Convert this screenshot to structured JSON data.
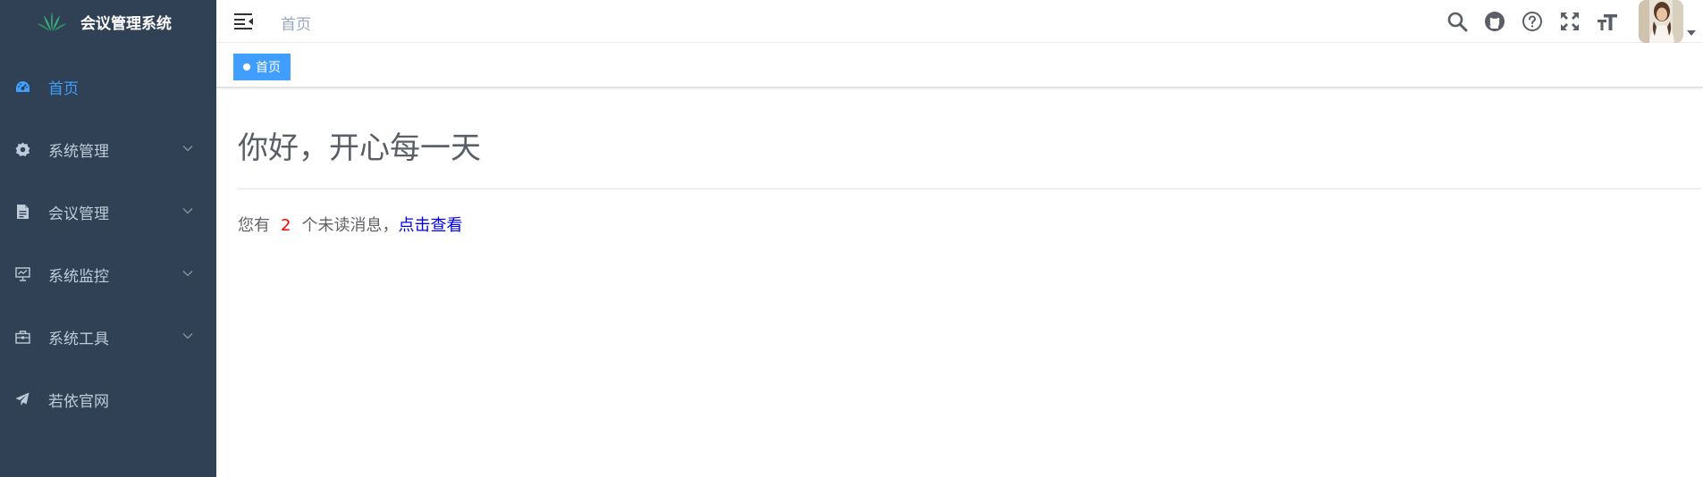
{
  "app": {
    "title": "会议管理系统"
  },
  "sidebar": {
    "items": [
      {
        "label": "首页",
        "icon": "dashboard-icon",
        "active": true,
        "has_children": false
      },
      {
        "label": "系统管理",
        "icon": "settings-icon",
        "active": false,
        "has_children": true
      },
      {
        "label": "会议管理",
        "icon": "document-icon",
        "active": false,
        "has_children": true
      },
      {
        "label": "系统监控",
        "icon": "monitor-icon",
        "active": false,
        "has_children": true
      },
      {
        "label": "系统工具",
        "icon": "toolbox-icon",
        "active": false,
        "has_children": true
      },
      {
        "label": "若依官网",
        "icon": "paper-plane-icon",
        "active": false,
        "has_children": false
      }
    ]
  },
  "navbar": {
    "breadcrumb": "首页",
    "icons": [
      "search-icon",
      "github-icon",
      "help-icon",
      "fullscreen-icon",
      "font-size-icon"
    ]
  },
  "tags": {
    "active_tag": "首页"
  },
  "main": {
    "greeting": "你好，开心每一天",
    "message_prefix": "您有",
    "unread_count": "2",
    "message_middle": "个未读消息，",
    "message_link": "点击查看"
  },
  "colors": {
    "sidebar_bg": "#304156",
    "active": "#409eff",
    "menu_text": "#bfcbd9",
    "count": "#ff0000"
  }
}
